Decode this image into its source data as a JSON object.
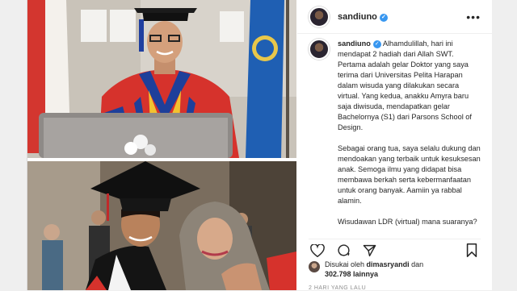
{
  "post": {
    "username": "sandiuno",
    "verified_symbol": "✓",
    "more_symbol": "•••",
    "caption": "Alhamdulillah, hari ini mendapat 2 hadiah dari Allah SWT. Pertama adalah gelar Doktor yang saya terima dari Universitas Pelita Harapan dalam wisuda yang dilakukan secara virtual. Yang kedua, anakku Amyra baru saja diwisuda, mendapatkan gelar Bachelornya (S1) dari Parsons School of Design.\n\nSebagai orang tua, saya selalu dukung dan mendoakan yang terbaik untuk kesuksesan anak. Semoga ilmu yang didapat bisa membawa berkah serta kebermanfaatan untuk orang banyak. Aamiin ya rabbal alamin.\n\nWisudawan LDR (virtual) mana suaranya?",
    "likes_prefix": "Disukai oleh",
    "likes_user": "dimasryandi",
    "likes_and": "dan",
    "likes_count": "302.798 lainnya",
    "timestamp": "2 HARI YANG LALU"
  },
  "icons": {
    "like": "heart-icon",
    "comment": "comment-icon",
    "share": "share-icon",
    "save": "bookmark-icon"
  },
  "colors": {
    "gown_red": "#d6322c",
    "gown_yellow": "#f2c230",
    "gown_blue": "#1e3f9a",
    "verified": "#3897f0"
  }
}
